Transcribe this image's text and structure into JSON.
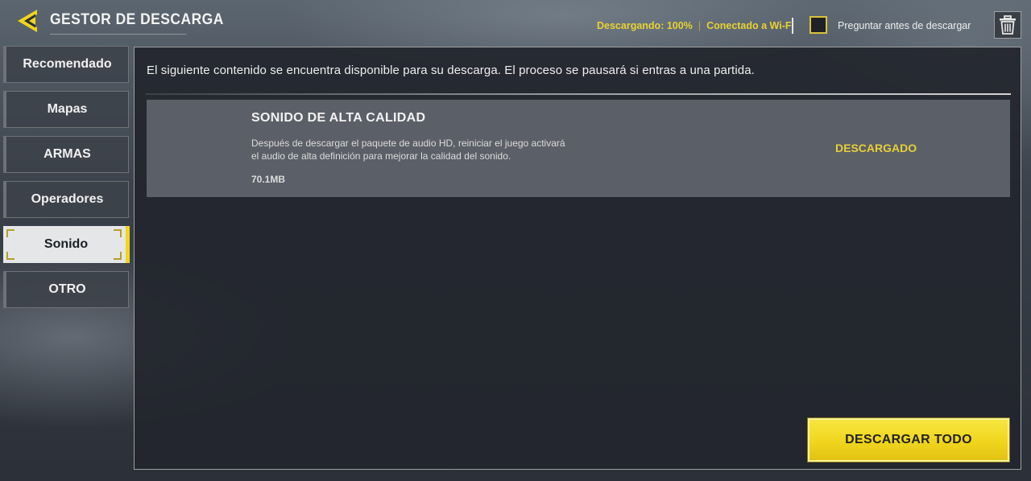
{
  "header": {
    "back_icon": "back-arrow-icon",
    "title": "GESTOR DE DESCARGA",
    "status_downloading": "Descargando: 100%",
    "status_separator": "|",
    "status_connection": "Conectado a Wi-Fi",
    "ask_before_download_label": "Preguntar antes de descargar",
    "ask_before_download_checked": false,
    "trash_icon": "trash-icon"
  },
  "sidebar": {
    "items": [
      {
        "label": "Recomendado",
        "active": false
      },
      {
        "label": "Mapas",
        "active": false
      },
      {
        "label": "ARMAS",
        "active": false
      },
      {
        "label": "Operadores",
        "active": false
      },
      {
        "label": "Sonido",
        "active": true
      },
      {
        "label": "OTRO",
        "active": false
      }
    ]
  },
  "main": {
    "intro": "El siguiente contenido se encuentra disponible para su descarga. El proceso se pausará si entras a una partida.",
    "items": [
      {
        "title": "SONIDO DE ALTA CALIDAD",
        "description_line1": "Después de descargar el paquete de audio HD, reiniciar el juego activará",
        "description_line2": "el audio de alta definición para mejorar la calidad del sonido.",
        "size": "70.1MB",
        "status": "DESCARGADO"
      }
    ],
    "download_all_label": "DESCARGAR TODO"
  },
  "colors": {
    "accent_yellow": "#f1d51c",
    "status_yellow": "#e7cf38"
  }
}
